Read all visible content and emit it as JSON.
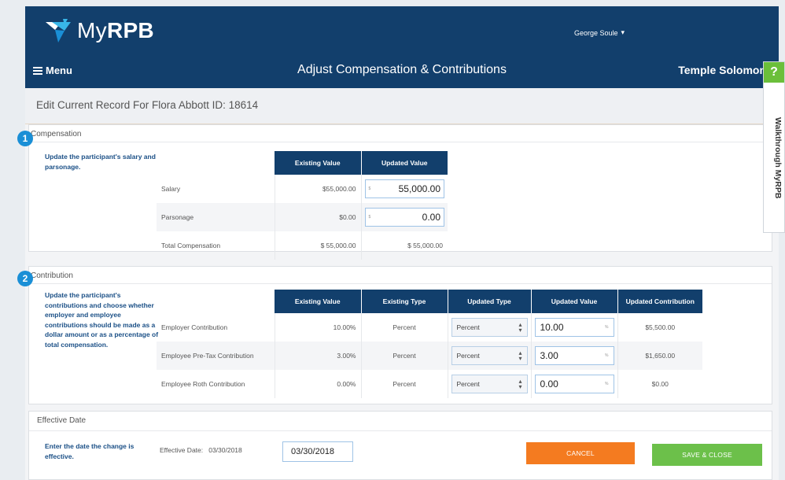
{
  "app": {
    "logo_text_light": "My",
    "logo_text_bold": "RPB",
    "user_name": "George Soule"
  },
  "nav": {
    "menu_label": "Menu",
    "page_title": "Adjust Compensation & Contributions",
    "org_name": "Temple Solomon"
  },
  "record": {
    "title": "Edit Current Record For Flora Abbott ID: 18614"
  },
  "walkthrough": {
    "question_mark": "?",
    "label": "Walkthrough MyRPB"
  },
  "compensation": {
    "badge": "1",
    "title": "Compensation",
    "description": "Update the participant's salary and parsonage.",
    "headers": [
      "Existing Value",
      "Updated Value"
    ],
    "rows": [
      {
        "label": "Salary",
        "existing": "$55,000.00",
        "currency": "$",
        "updated": "55,000.00"
      },
      {
        "label": "Parsonage",
        "existing": "$0.00",
        "currency": "$",
        "updated": "0.00"
      }
    ],
    "total": {
      "label": "Total Compensation",
      "existing": "$ 55,000.00",
      "updated": "$ 55,000.00"
    }
  },
  "contribution": {
    "badge": "2",
    "title": "Contribution",
    "description": "Update the participant's contributions and choose whether employer and employee contributions should be made as a dollar amount or as a percentage of total compensation.",
    "headers": [
      "Existing Value",
      "Existing Type",
      "Updated Type",
      "Updated Value",
      "Updated Contribution"
    ],
    "rows": [
      {
        "label": "Employer Contribution",
        "existing_value": "10.00%",
        "existing_type": "Percent",
        "updated_type": "Percent",
        "updated_value": "10.00",
        "pct": "%",
        "updated_contribution": "$5,500.00"
      },
      {
        "label": "Employee Pre-Tax Contribution",
        "existing_value": "3.00%",
        "existing_type": "Percent",
        "updated_type": "Percent",
        "updated_value": "3.00",
        "pct": "%",
        "updated_contribution": "$1,650.00"
      },
      {
        "label": "Employee Roth Contribution",
        "existing_value": "0.00%",
        "existing_type": "Percent",
        "updated_type": "Percent",
        "updated_value": "0.00",
        "pct": "%",
        "updated_contribution": "$0.00"
      }
    ]
  },
  "effective": {
    "title": "Effective Date",
    "description": "Enter the date the change is effective.",
    "label": "Effective Date:",
    "current": "03/30/2018",
    "input_value": "03/30/2018",
    "cancel_label": "CANCEL",
    "save_label": "SAVE & CLOSE",
    "cancel_color": "#f47b20",
    "save_color": "#6cc04a"
  }
}
